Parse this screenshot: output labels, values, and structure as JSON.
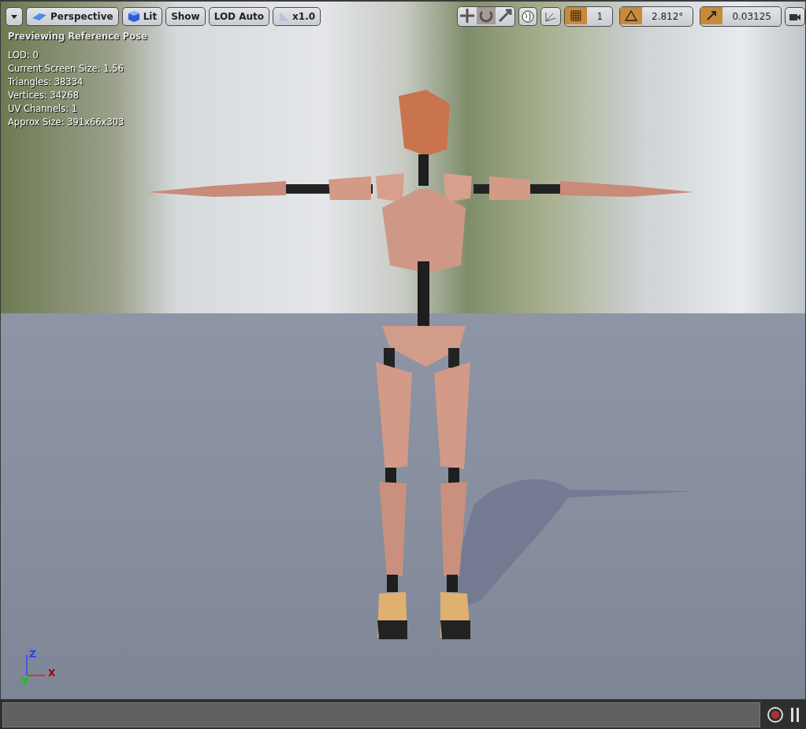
{
  "toolbar": {
    "left": [
      {
        "kind": "menu"
      },
      {
        "kind": "perspective",
        "label": "Perspective"
      },
      {
        "kind": "lit",
        "label": "Lit"
      },
      {
        "kind": "plain",
        "label": "Show"
      },
      {
        "kind": "plain",
        "label": "LOD Auto"
      },
      {
        "kind": "speed",
        "label": "x1.0"
      }
    ],
    "transform_modes": [
      {
        "kind": "move",
        "selected": false
      },
      {
        "kind": "rotate",
        "selected": true
      },
      {
        "kind": "scale",
        "selected": false
      }
    ],
    "snaps": [
      {
        "kind": "grid",
        "on": true,
        "value": "1"
      },
      {
        "kind": "rotate",
        "on": true,
        "value": "2.812°"
      },
      {
        "kind": "scale",
        "on": true,
        "value": "0.03125"
      }
    ]
  },
  "overlay": {
    "title": "Previewing Reference Pose",
    "stats": [
      "LOD: 0",
      "Current Screen Size: 1.56",
      "Triangles: 38334",
      "Vertices: 34268",
      "UV Channels: 1",
      "Approx Size: 391x66x303"
    ]
  },
  "axes": [
    {
      "kind": "z",
      "label": "Z"
    },
    {
      "kind": "y",
      "label": "Y"
    },
    {
      "kind": "x",
      "label": "X"
    }
  ],
  "timeline": {
    "recording": false
  }
}
